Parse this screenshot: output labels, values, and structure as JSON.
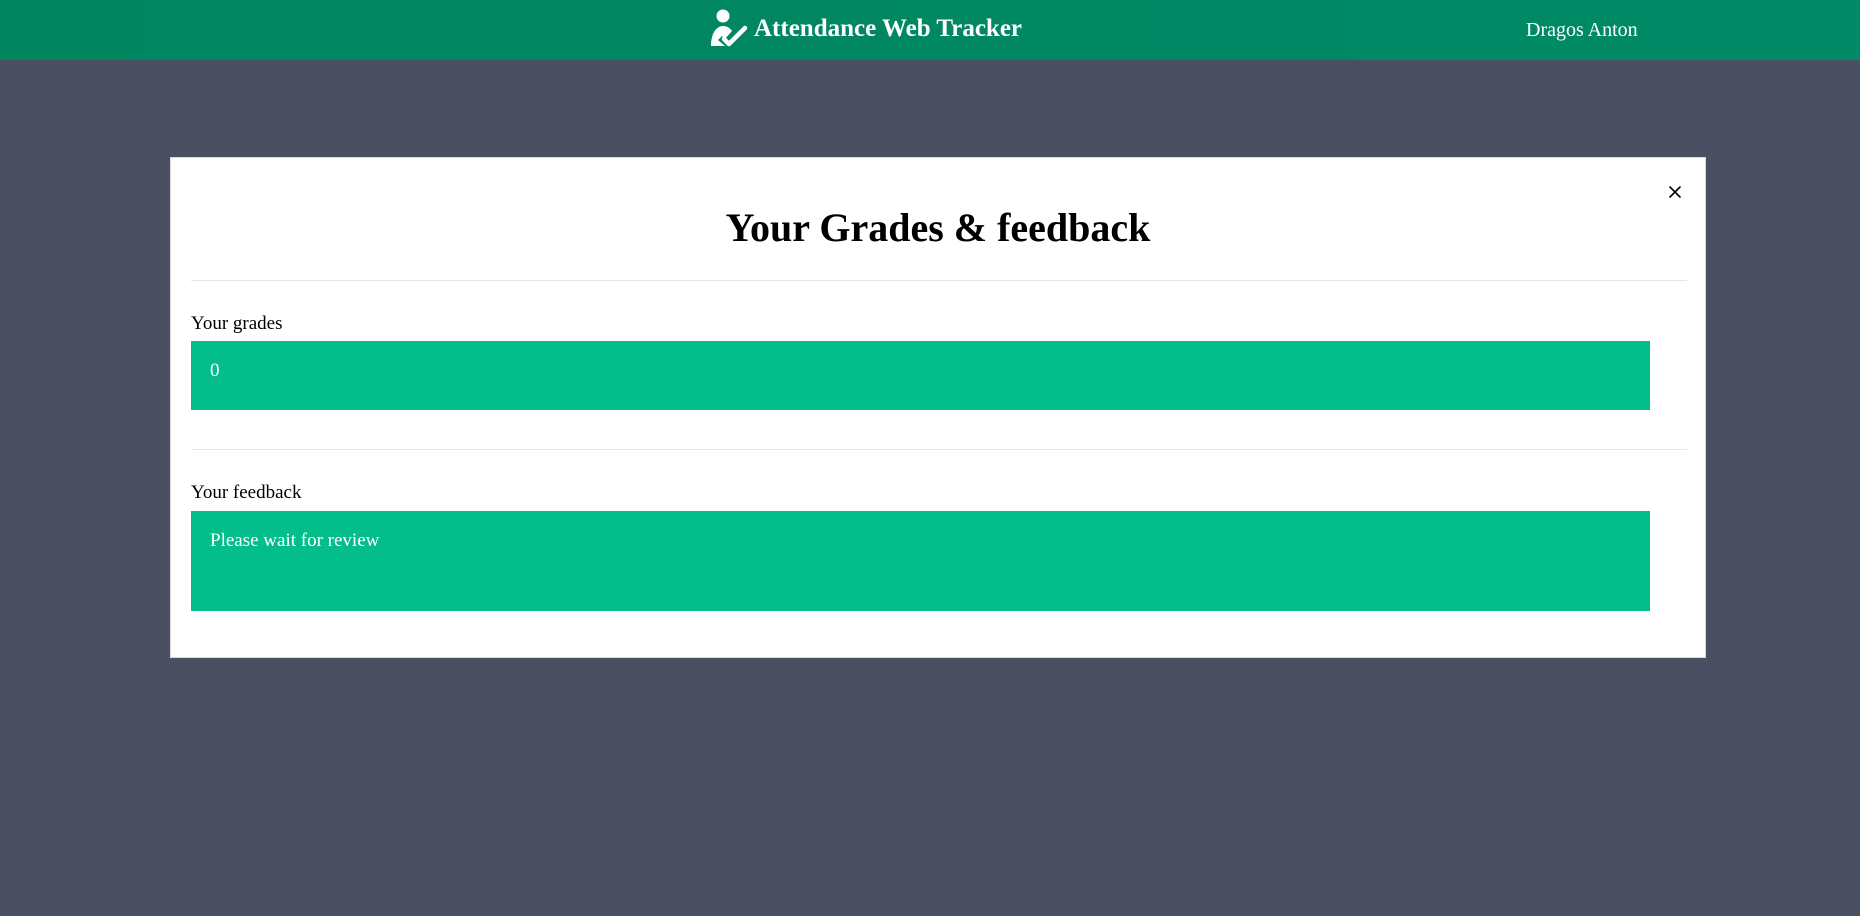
{
  "header": {
    "app_title": "Attendance Web Tracker",
    "app_icon": "user-check-icon",
    "user_name": "Dragos Anton",
    "colors": {
      "bar": "#008a66",
      "text": "#ffffff"
    }
  },
  "modal": {
    "title": "Your Grades & feedback",
    "close_icon": "close-icon",
    "grades": {
      "label": "Your grades",
      "value": "0"
    },
    "feedback": {
      "label": "Your feedback",
      "value": "Please wait for review"
    },
    "colors": {
      "field_bg": "#03be8b",
      "backdrop": "#4a5061"
    }
  }
}
